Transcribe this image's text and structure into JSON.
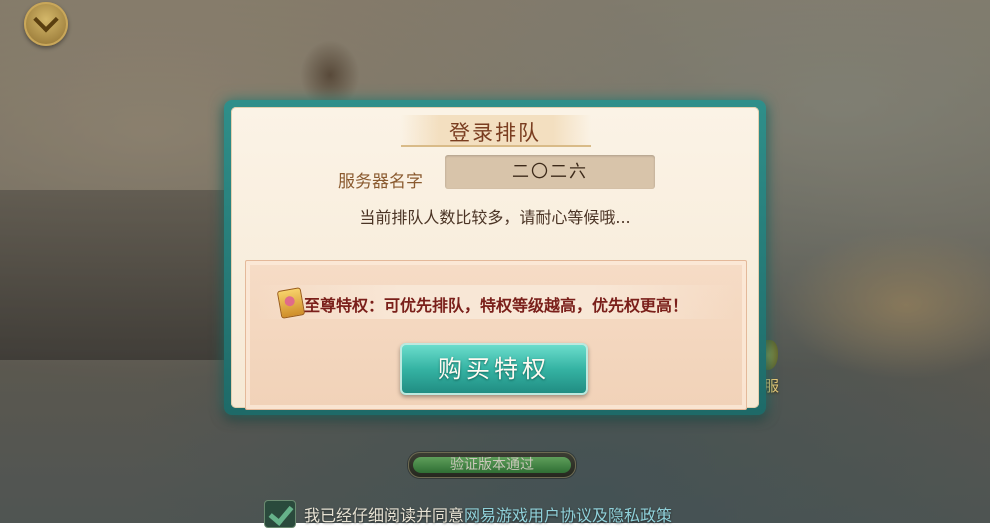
{
  "dialog": {
    "title": "登录排队",
    "server_label": "服务器名字",
    "server_name": "二〇二六",
    "queue_message": "当前排队人数比较多，请耐心等候哦...",
    "privilege_text": "至尊特权：可优先排队，特权等级越高，优先权更高！",
    "buy_button_label": "购买特权"
  },
  "background": {
    "side_label": "服",
    "verify_text": "验证版本通过",
    "verify_progress": 1.0,
    "agreement_prefix": "我已经仔细阅读并同意",
    "agreement_link": "网易游戏用户协议及隐私政策",
    "agreement_checked": true
  },
  "icons": {
    "collapse": "chevron-down-icon",
    "privilege": "privilege-card-icon",
    "checkbox": "check-icon"
  },
  "colors": {
    "accent_teal": "#35b3a3",
    "title_brown": "#7a3d20",
    "privilege_red": "#7a1f1a"
  }
}
